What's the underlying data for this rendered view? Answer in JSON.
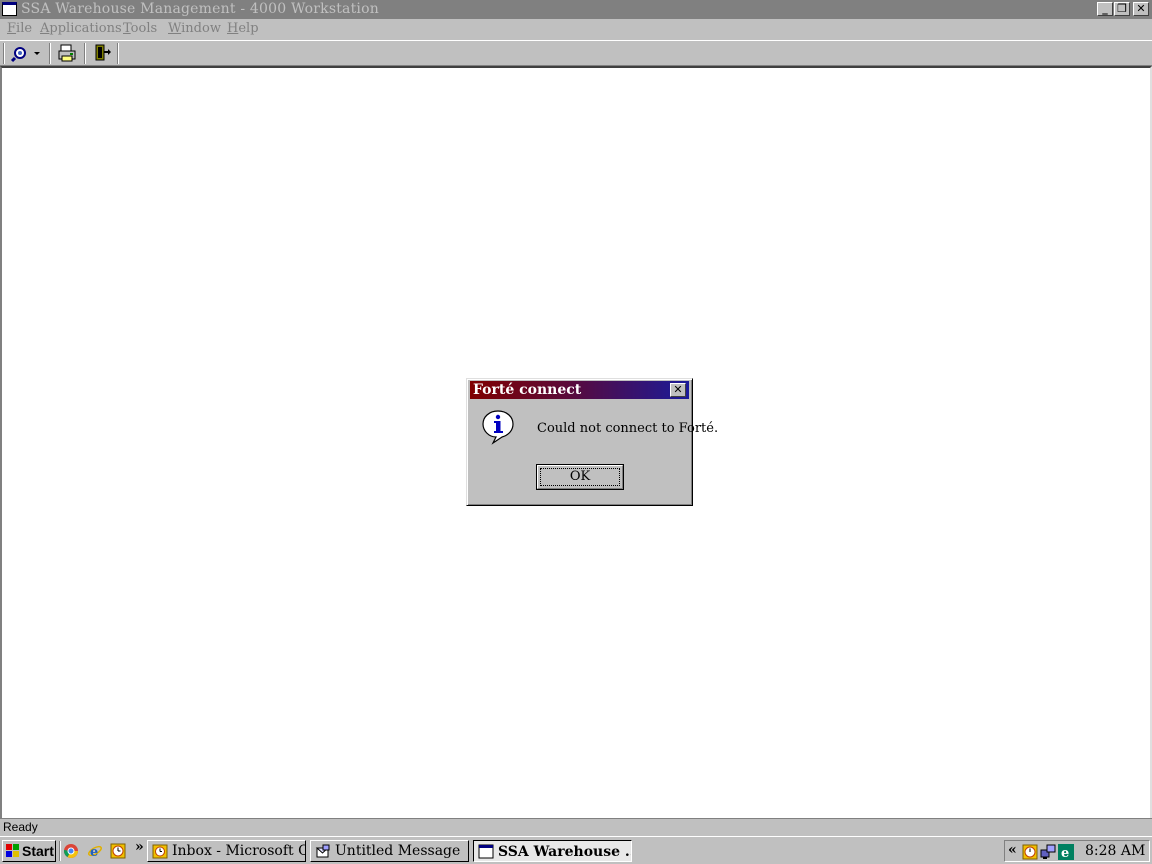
{
  "window": {
    "title": "SSA Warehouse Management - 4000 Workstation"
  },
  "menu": [
    {
      "key": "F",
      "rest": "ile"
    },
    {
      "key": "A",
      "rest": "pplications"
    },
    {
      "key": "T",
      "rest": "ools"
    },
    {
      "key": "W",
      "rest": "indow"
    },
    {
      "key": "H",
      "rest": "elp"
    }
  ],
  "toolbar": {
    "icons": [
      "search-dropdown-icon",
      "printer-icon",
      "exit-door-icon"
    ]
  },
  "status": {
    "text": "Ready"
  },
  "dialog": {
    "title": "Forté connect",
    "message": "Could not connect to Forté.",
    "ok_label": "OK",
    "icon": "info-icon"
  },
  "taskbar": {
    "start_label": "Start",
    "quick_launch": [
      "chrome-icon",
      "internet-explorer-icon",
      "clock-icon"
    ],
    "overflow_label": "»",
    "tasks": [
      {
        "label": "Inbox - Microsoft O...",
        "icon": "outlook-icon",
        "active": false
      },
      {
        "label": "Untitled Message",
        "icon": "message-icon",
        "active": false
      },
      {
        "label": "SSA Warehouse ...",
        "icon": "window-icon",
        "active": true
      }
    ],
    "tray_chevron": "«",
    "clock": "8:28 AM"
  },
  "colors": {
    "desktop_gray": "#c0c0c0",
    "inactive_title": "#808080",
    "dialog_title_start": "#800000",
    "dialog_title_end": "#1a1a9a"
  }
}
